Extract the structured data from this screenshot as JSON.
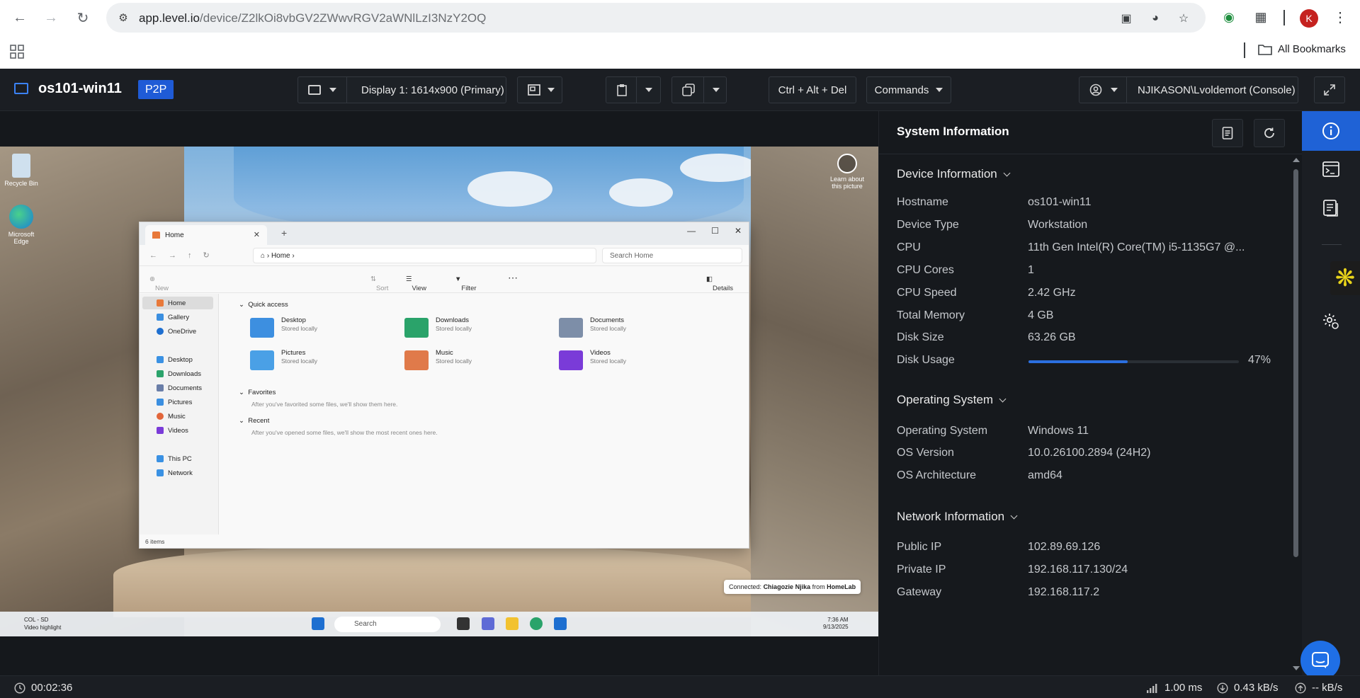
{
  "browser": {
    "url_host": "app.level.io",
    "url_path": "/device/Z2lkOi8vbGV2ZWwvRGV2aWNlLzI3NzY2OQ",
    "avatar_letter": "K",
    "bookmarks_label": "All Bookmarks"
  },
  "header": {
    "device_name": "os101-win11",
    "badge": "P2P",
    "display_label": "Display 1: 1614x900 (Primary)",
    "cad_label": "Ctrl + Alt + Del",
    "commands_label": "Commands",
    "user_label": "NJIKASON\\Lvoldemort (Console)"
  },
  "remote": {
    "desktop_icons": [
      {
        "label": "Recycle Bin"
      },
      {
        "label": "Microsoft Edge"
      },
      {
        "label": "Learn about this picture"
      }
    ],
    "explorer": {
      "tab_label": "Home",
      "breadcrumb": "Home",
      "search_placeholder": "Search Home",
      "cmd": {
        "new": "New",
        "sort": "Sort",
        "view": "View",
        "filter": "Filter",
        "details": "Details"
      },
      "nav": [
        "Home",
        "Gallery",
        "OneDrive",
        "Desktop",
        "Downloads",
        "Documents",
        "Pictures",
        "Music",
        "Videos",
        "This PC",
        "Network"
      ],
      "quick_access_title": "Quick access",
      "quick_access": [
        {
          "name": "Desktop",
          "sub": "Stored locally"
        },
        {
          "name": "Downloads",
          "sub": "Stored locally"
        },
        {
          "name": "Documents",
          "sub": "Stored locally"
        },
        {
          "name": "Pictures",
          "sub": "Stored locally"
        },
        {
          "name": "Music",
          "sub": "Stored locally"
        },
        {
          "name": "Videos",
          "sub": "Stored locally"
        }
      ],
      "favorites_title": "Favorites",
      "favorites_hint": "After you've favorited some files, we'll show them here.",
      "recent_title": "Recent",
      "recent_hint": "After you've opened some files, we'll show the most recent ones here.",
      "status": "6 items"
    },
    "taskbar": {
      "weather_line1": "COL - SD",
      "weather_line2": "Video highlight",
      "search_label": "Search",
      "time": "7:36 AM",
      "date": "9/13/2025"
    },
    "toast": {
      "prefix": "Connected:",
      "user": "Chiagozie Njika",
      "middle": "from",
      "host": "HomeLab"
    }
  },
  "panel": {
    "title": "System Information",
    "device_info": {
      "title": "Device Information",
      "rows": [
        {
          "k": "Hostname",
          "v": "os101-win11"
        },
        {
          "k": "Device Type",
          "v": "Workstation"
        },
        {
          "k": "CPU",
          "v": "11th Gen Intel(R) Core(TM) i5-1135G7 @..."
        },
        {
          "k": "CPU Cores",
          "v": "1"
        },
        {
          "k": "CPU Speed",
          "v": "2.42 GHz"
        },
        {
          "k": "Total Memory",
          "v": "4 GB"
        },
        {
          "k": "Disk Size",
          "v": "63.26 GB"
        }
      ],
      "disk_usage_label": "Disk Usage",
      "disk_usage_value": 0.47,
      "disk_usage_text": "47%"
    },
    "os": {
      "title": "Operating System",
      "rows": [
        {
          "k": "Operating System",
          "v": "Windows 11"
        },
        {
          "k": "OS Version",
          "v": "10.0.26100.2894 (24H2)"
        },
        {
          "k": "OS Architecture",
          "v": "amd64"
        }
      ]
    },
    "network": {
      "title": "Network Information",
      "rows": [
        {
          "k": "Public IP",
          "v": "102.89.69.126"
        },
        {
          "k": "Private IP",
          "v": "192.168.117.130/24"
        },
        {
          "k": "Gateway",
          "v": "192.168.117.2"
        }
      ]
    }
  },
  "footer": {
    "session_time": "00:02:36",
    "latency": "1.00 ms",
    "download": "0.43 kB/s",
    "upload": "-- kB/s"
  },
  "colors": {
    "accent": "#1f62d6",
    "badge": "#1f5bd6",
    "disk_bar": "#2b6fe0"
  }
}
